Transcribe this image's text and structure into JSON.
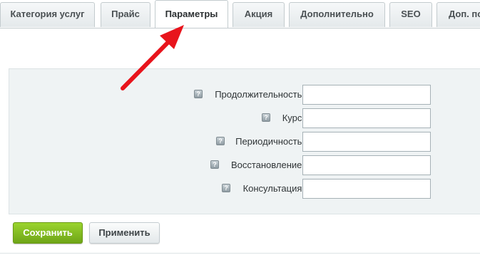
{
  "tabs": [
    {
      "label": "Категория услуг",
      "active": false
    },
    {
      "label": "Прайс",
      "active": false
    },
    {
      "label": "Параметры",
      "active": true
    },
    {
      "label": "Акция",
      "active": false
    },
    {
      "label": "Дополнительно",
      "active": false
    },
    {
      "label": "SEO",
      "active": false
    },
    {
      "label": "Доп. по",
      "active": false
    }
  ],
  "form": {
    "help_icon_glyph": "?",
    "fields": [
      {
        "label": "Продолжительность:",
        "value": ""
      },
      {
        "label": "Курс:",
        "value": ""
      },
      {
        "label": "Периодичность:",
        "value": ""
      },
      {
        "label": "Восстановление:",
        "value": ""
      },
      {
        "label": "Консультация:",
        "value": ""
      }
    ]
  },
  "buttons": {
    "save_label": "Сохранить",
    "apply_label": "Применить"
  },
  "colors": {
    "save_button": "#7fb520",
    "annotation_arrow": "#e8141c",
    "panel_background": "#eff3f4"
  },
  "icons": {
    "help": "help-icon",
    "annotation": "arrow-icon"
  }
}
